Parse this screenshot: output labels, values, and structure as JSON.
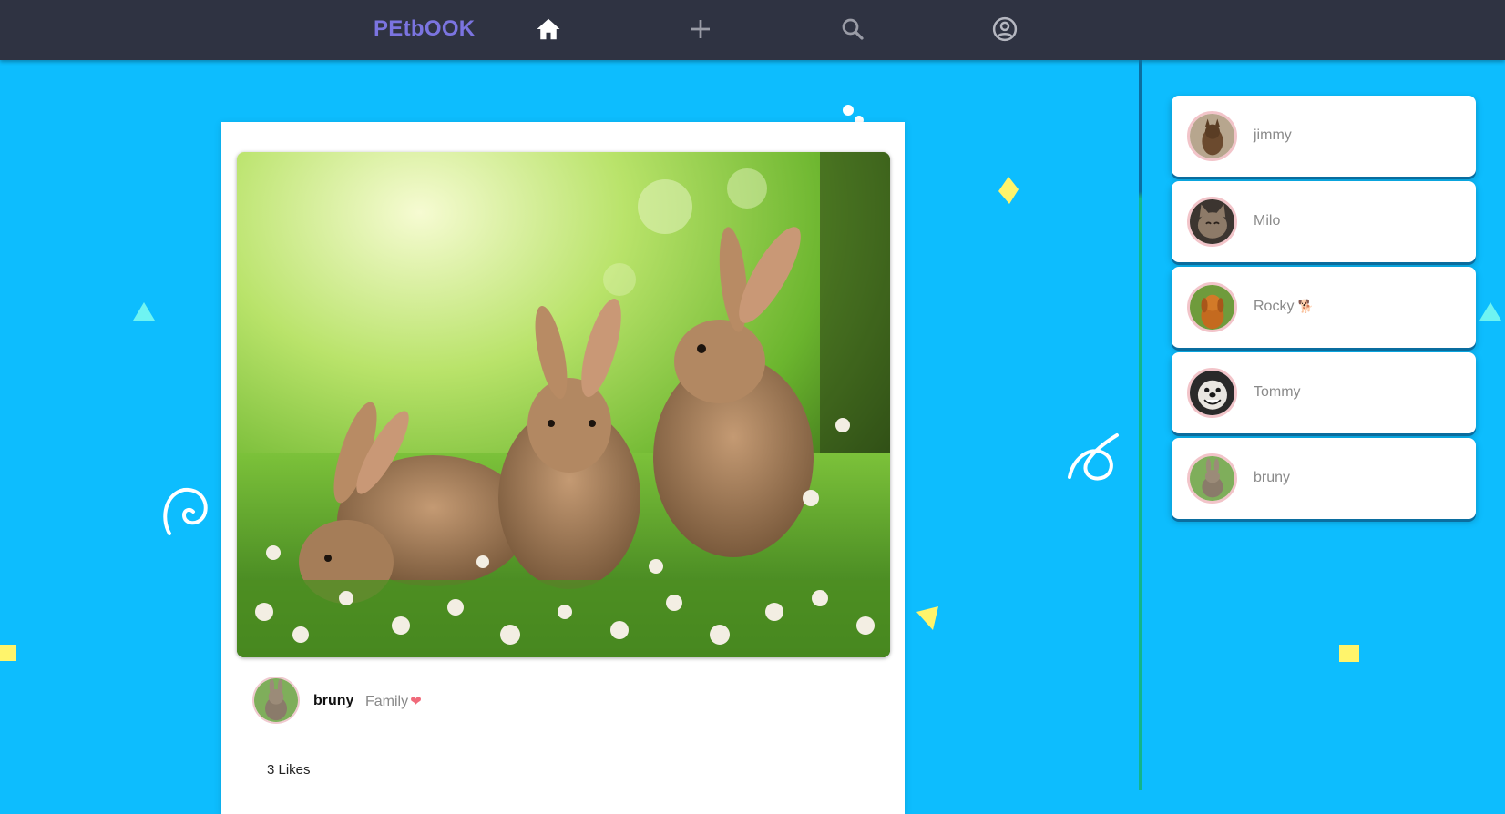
{
  "app": {
    "brand": "PEtbOOK"
  },
  "nav": {
    "items": [
      {
        "icon": "home-icon",
        "active": true
      },
      {
        "icon": "plus-icon",
        "active": false
      },
      {
        "icon": "search-icon",
        "active": false
      },
      {
        "icon": "account-circle-icon",
        "active": false
      }
    ]
  },
  "post": {
    "photo": "three-rabbits-in-grass",
    "author": "bruny",
    "caption": "Family",
    "caption_emoji": "❤",
    "likes": "3 Likes"
  },
  "friends": [
    {
      "name": "jimmy",
      "avatar": "dog-avatar"
    },
    {
      "name": "Milo",
      "avatar": "cat-avatar"
    },
    {
      "name": "Rocky",
      "emoji": "🐕",
      "avatar": "golden-retriever-avatar"
    },
    {
      "name": "Tommy",
      "avatar": "smiling-dog-avatar"
    },
    {
      "name": "bruny",
      "avatar": "rabbit-avatar"
    }
  ],
  "colors": {
    "background": "#0dbdfe",
    "navbar": "#2f3342",
    "brand": "#7b74e0",
    "card": "#ffffff",
    "card_shadow": "#0b6ea0",
    "heart": "#f06a7a",
    "confetti_yellow": "#fff46b",
    "confetti_cyan": "#6ff4f2"
  }
}
